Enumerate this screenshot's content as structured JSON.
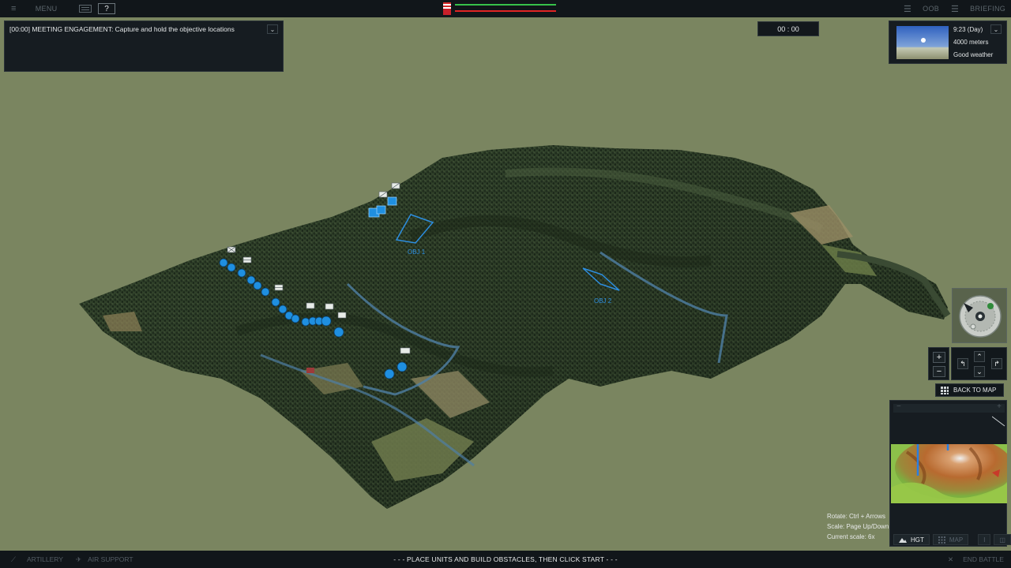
{
  "topbar": {
    "menu_label": "MENU",
    "help_label": "?",
    "oob_label": "OOB",
    "briefing_label": "BRIEFING"
  },
  "briefing_panel": {
    "text": "[00:00] MEETING ENGAGEMENT: Capture and hold the objective locations",
    "dropdown_glyph": "⌄"
  },
  "timer": {
    "value": "00 : 00"
  },
  "weather": {
    "time": "9:23 (Day)",
    "visibility": "4000 meters",
    "condition": "Good weather",
    "dropdown_glyph": "⌄"
  },
  "objectives": [
    {
      "label": "OBJ 1"
    },
    {
      "label": "OBJ 2"
    }
  ],
  "nav": {
    "zoom_in": "+",
    "zoom_out": "−",
    "up": "⌃",
    "down": "⌄",
    "rotate_left": "↰",
    "rotate_right": "↱",
    "back_to_map": "BACK TO MAP"
  },
  "minimap": {
    "minus": "−",
    "plus": "+",
    "hints": [
      "Rotate: Ctrl + Arrows",
      "Scale: Page Up/Down",
      "Current scale: 6x"
    ],
    "tab_hgt": "HGT",
    "tab_map": "MAP"
  },
  "bottombar": {
    "artillery": "ARTILLERY",
    "air_support": "AIR SUPPORT",
    "instruction": "- - -   PLACE UNITS AND BUILD OBSTACLES, THEN CLICK START   - - -",
    "end_battle": "END BATTLE"
  },
  "colors": {
    "background": "#7a8560",
    "forest": "#2a3a26",
    "unit_blue": "#1f8fe0",
    "bar_green": "#37c24a",
    "bar_red": "#e02424"
  }
}
